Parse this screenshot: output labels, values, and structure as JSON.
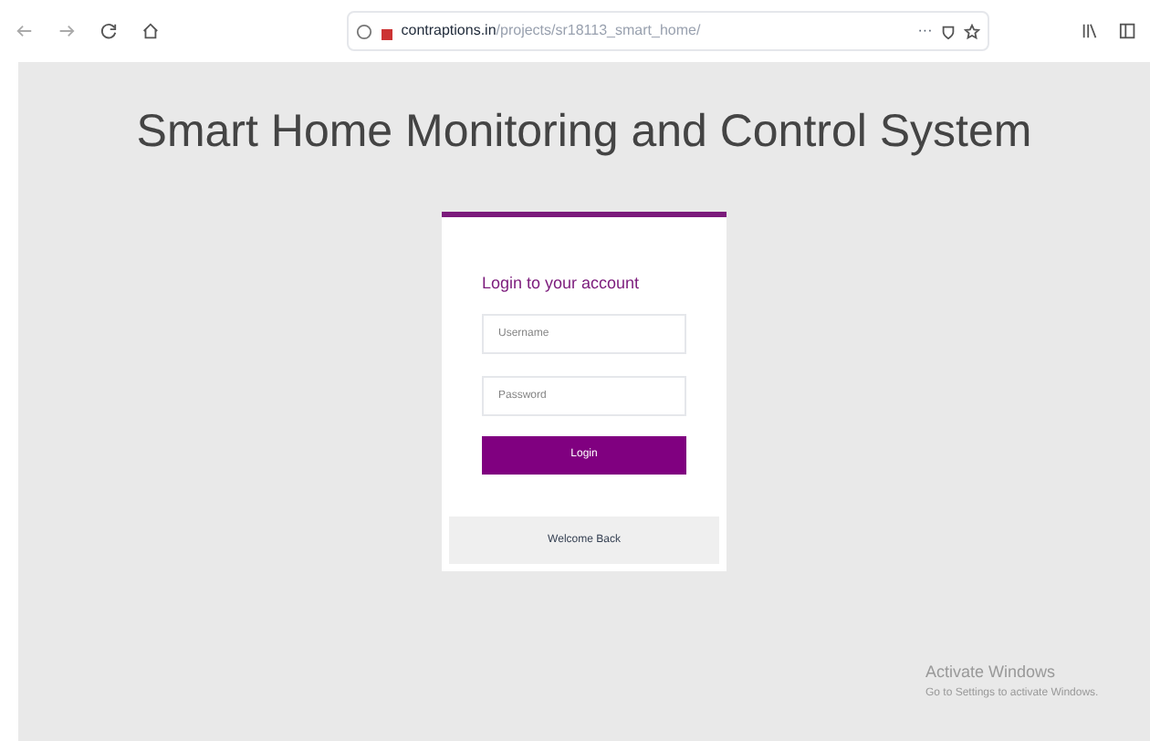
{
  "browser": {
    "url_domain": "contraptions.in",
    "url_path": "/projects/sr18113_smart_home/",
    "menu_dots": "···"
  },
  "page": {
    "title": "Smart Home Monitoring and Control System"
  },
  "login": {
    "heading": "Login to your account",
    "username": {
      "placeholder": "Username"
    },
    "password": {
      "placeholder": "Password"
    },
    "button": "Login",
    "footer": "Welcome Back"
  },
  "os_notice": {
    "title": "Activate Windows",
    "subtitle": "Go to Settings to activate Windows."
  }
}
